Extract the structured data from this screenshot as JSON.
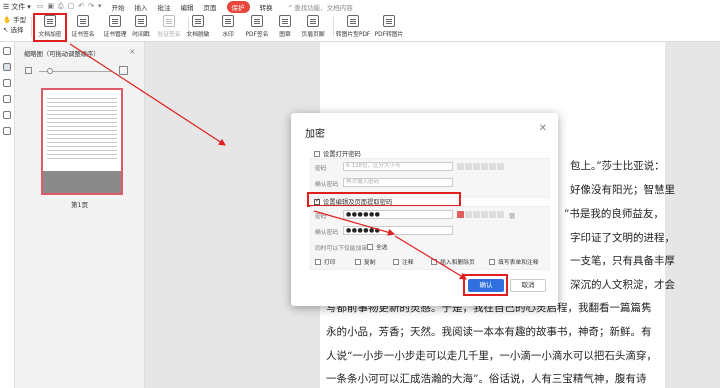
{
  "menubar": {
    "file_label": "文件",
    "tabs": [
      "开始",
      "插入",
      "批注",
      "编辑",
      "页面",
      "保护",
      "转换"
    ],
    "active_tab": "保护",
    "search_placeholder": "查找功能、文档内容"
  },
  "lefttools": {
    "hand": "手型",
    "select": "选择"
  },
  "ribbon": {
    "buttons": [
      {
        "label": "文档加密",
        "dim": false
      },
      {
        "label": "证书签名",
        "dim": false,
        "dropdown": true
      },
      {
        "label": "证书管理",
        "dim": false
      },
      {
        "label": "时间戳",
        "dim": false
      },
      {
        "label": "验证签名",
        "dim": true
      },
      {
        "label": "文档脱敏",
        "dim": false,
        "dropdown": true
      },
      {
        "label": "水印",
        "dim": false,
        "dropdown": true
      },
      {
        "label": "PDF签名",
        "dim": false,
        "dropdown": true
      },
      {
        "label": "图章",
        "dim": false,
        "dropdown": true
      },
      {
        "label": "页眉页脚",
        "dim": false,
        "dropdown": true
      },
      {
        "label": "转图片型PDF",
        "dim": false
      },
      {
        "label": "PDF转图片",
        "dim": false
      }
    ]
  },
  "thumbpanel": {
    "header": "缩略图（可拖动调整顺序）",
    "page_label": "第1页"
  },
  "document": {
    "lines": [
      "包上。”莎士比亚说：",
      "好像没有阳光；智慧里",
      "”书是我的良师益友，",
      "字印证了文明的进程，",
      "一支笔，只有具备丰厚",
      "深沉的人文积淀，才会",
      "写都前事物更新的灵感。于是，我在自己的心灵启程，我翻看一篇篇隽",
      "永的小品，芳香；天然。我阅读一本本有趣的故事书，神奇；新鲜。有",
      "人说“一小步一小步走可以走几千里，一小滴一小滴水可以把石头滴穿，",
      "一条条小河可以汇成浩瀚的大海”。俗话说，人有三宝精气神，腹有诗"
    ]
  },
  "modal": {
    "title": "加密",
    "open_section": {
      "checkbox_label": "设置打开密码",
      "checked": false,
      "password_label": "密码",
      "password_placeholder": "6-128位，区分大小写",
      "confirm_label": "确认密码",
      "confirm_placeholder": "再次输入密码"
    },
    "edit_section": {
      "checkbox_label": "设置编辑及页面提取密码",
      "checked": true,
      "password_label": "密码",
      "password_value": "●●●●●●",
      "strength_label": "弱",
      "confirm_label": "确认密码",
      "confirm_value": "●●●●●●",
      "permissions_title": "同时可以下仅能加审",
      "select_all": "全选",
      "permissions": [
        "打印",
        "复制",
        "注释",
        "插入和删除页",
        "填写表单和注释"
      ]
    },
    "ok_label": "确认",
    "cancel_label": "取消"
  },
  "colors": {
    "accent": "#2f6fe0",
    "highlight": "#e02020",
    "active_tab_bg": "#e8463c"
  }
}
